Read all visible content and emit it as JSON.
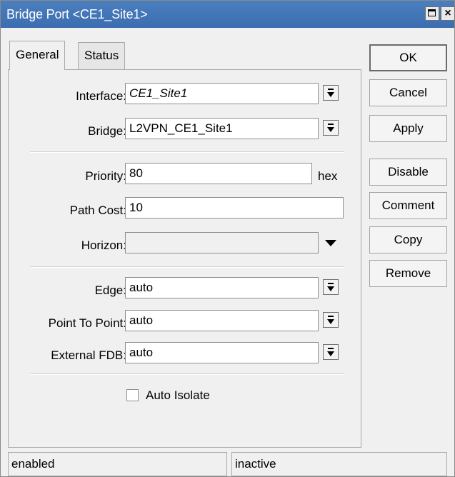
{
  "window": {
    "title": "Bridge Port <CE1_Site1>",
    "close_glyph": "×"
  },
  "tabs": [
    {
      "label": "General",
      "active": true
    },
    {
      "label": "Status",
      "active": false
    }
  ],
  "form": {
    "interface": {
      "label": "Interface:",
      "value": "CE1_Site1"
    },
    "bridge": {
      "label": "Bridge:",
      "value": "L2VPN_CE1_Site1"
    },
    "priority": {
      "label": "Priority:",
      "value": "80",
      "unit": "hex"
    },
    "path_cost": {
      "label": "Path Cost:",
      "value": "10"
    },
    "horizon": {
      "label": "Horizon:",
      "value": ""
    },
    "edge": {
      "label": "Edge:",
      "value": "auto"
    },
    "point_to_point": {
      "label": "Point To Point:",
      "value": "auto"
    },
    "external_fdb": {
      "label": "External FDB:",
      "value": "auto"
    },
    "auto_isolate": {
      "label": "Auto Isolate",
      "checked": false
    }
  },
  "buttons": {
    "ok": "OK",
    "cancel": "Cancel",
    "apply": "Apply",
    "disable": "Disable",
    "comment": "Comment",
    "copy": "Copy",
    "remove": "Remove"
  },
  "status": {
    "left": "enabled",
    "right": "inactive"
  },
  "colors": {
    "titlebar": "#3c6db0",
    "window_bg": "#f0f0f0"
  },
  "icons": [
    "maximize-icon",
    "close-icon",
    "dropdown-icon",
    "checkbox-icon"
  ]
}
